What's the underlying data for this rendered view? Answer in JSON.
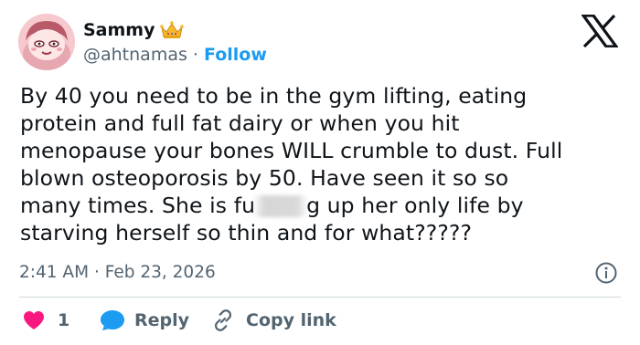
{
  "tweet": {
    "author_name": "Sammy",
    "handle": "@ahtnamas",
    "separator": "·",
    "follow_label": "Follow",
    "text_lines": [
      "By 40 you need to be in the gym lifting, eating",
      "protein and full fat dairy or when you hit",
      "menopause your bones WILL crumble to dust.  Full",
      "blown osteoporosis by 50.  Have seen it so so",
      "many times.  She is fu",
      "g up her only life by",
      "starving herself so thin and for what?????"
    ],
    "time": "2:41 AM",
    "date": "Feb 23, 2026",
    "like_count": "1",
    "reply_label": "Reply",
    "copy_link_label": "Copy link"
  },
  "icons": {
    "crown": "crown-icon",
    "x_logo": "x-logo-icon",
    "info": "info-icon",
    "heart": "heart-icon",
    "reply": "reply-bubble-icon",
    "link": "link-icon"
  },
  "colors": {
    "accent": "#1d9bf0",
    "heart": "#f91880",
    "muted": "#536471",
    "text": "#0f1419",
    "divider": "#cfd9de"
  }
}
